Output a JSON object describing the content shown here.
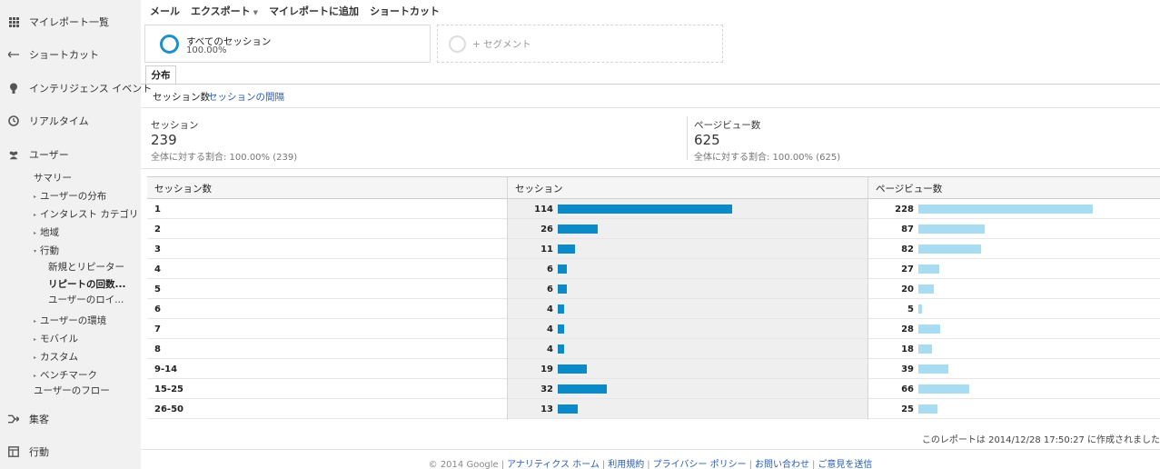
{
  "sidebar": {
    "top_items": [
      {
        "label": "マイレポート一覧",
        "icon": "grid-icon"
      },
      {
        "label": "ショートカット",
        "icon": "arrow-left-icon"
      },
      {
        "label": "インテリジェンス イベント",
        "icon": "bulb-icon"
      },
      {
        "label": "リアルタイム",
        "icon": "clock-icon"
      },
      {
        "label": "ユーザー",
        "icon": "users-icon"
      }
    ],
    "user_sub": [
      {
        "label": "サマリー",
        "expander": ""
      },
      {
        "label": "ユーザーの分布",
        "expander": "▸"
      },
      {
        "label": "インタレスト カテゴリ",
        "expander": "▸"
      },
      {
        "label": "地域",
        "expander": "▸"
      },
      {
        "label": "行動",
        "expander": "▾"
      },
      {
        "label": "新規とリピーター",
        "expander": ""
      },
      {
        "label": "リピートの回数...",
        "expander": ""
      },
      {
        "label": "ユーザーのロイ...",
        "expander": ""
      },
      {
        "label": "ユーザーの環境",
        "expander": "▸"
      },
      {
        "label": "モバイル",
        "expander": "▸"
      },
      {
        "label": "カスタム",
        "expander": "▸"
      },
      {
        "label": "ベンチマーク",
        "expander": "▸"
      },
      {
        "label": "ユーザーのフロー",
        "expander": ""
      }
    ],
    "bottom_items": [
      {
        "label": "集客",
        "icon": "acquisition-icon"
      },
      {
        "label": "行動",
        "icon": "behavior-icon"
      }
    ]
  },
  "toolbar": {
    "mail": "メール",
    "export": "エクスポート",
    "add_to_dashboard": "マイレポートに追加",
    "shortcut": "ショートカット"
  },
  "segments": {
    "all_title": "すべてのセッション",
    "all_pct": "100.00%",
    "add_label": "+ セグメント"
  },
  "tabs": {
    "distribution": "分布",
    "sub_sessions": "セッション数",
    "sub_interval": "セッションの間隔"
  },
  "metrics": {
    "sessions": {
      "label": "セッション",
      "value": "239",
      "sub": "全体に対する割合: 100.00% (239)"
    },
    "pageviews": {
      "label": "ページビュー数",
      "value": "625",
      "sub": "全体に対する割合: 100.00% (625)"
    }
  },
  "table": {
    "headers": {
      "key": "セッション数",
      "sessions": "セッション",
      "pageviews": "ページビュー数"
    },
    "max_sessions": 114,
    "max_pageviews": 228,
    "rows": [
      {
        "key": "1",
        "sessions": 114,
        "pageviews": 228
      },
      {
        "key": "2",
        "sessions": 26,
        "pageviews": 87
      },
      {
        "key": "3",
        "sessions": 11,
        "pageviews": 82
      },
      {
        "key": "4",
        "sessions": 6,
        "pageviews": 27
      },
      {
        "key": "5",
        "sessions": 6,
        "pageviews": 20
      },
      {
        "key": "6",
        "sessions": 4,
        "pageviews": 5
      },
      {
        "key": "7",
        "sessions": 4,
        "pageviews": 28
      },
      {
        "key": "8",
        "sessions": 4,
        "pageviews": 18
      },
      {
        "key": "9-14",
        "sessions": 19,
        "pageviews": 39
      },
      {
        "key": "15-25",
        "sessions": 32,
        "pageviews": 66
      },
      {
        "key": "26-50",
        "sessions": 13,
        "pageviews": 25
      }
    ]
  },
  "report_note": "このレポートは 2014/12/28 17:50:27 に作成されました",
  "footer": {
    "copyright": "© 2014 Google",
    "links": [
      "アナリティクス ホーム",
      "利用規約",
      "プライバシー ポリシー",
      "お問い合わせ",
      "ご意見を送信"
    ]
  },
  "colors": {
    "sessions_bar": "#0a8ac8",
    "pageviews_bar": "#a8dcf2",
    "ring": "#1e90c8"
  }
}
